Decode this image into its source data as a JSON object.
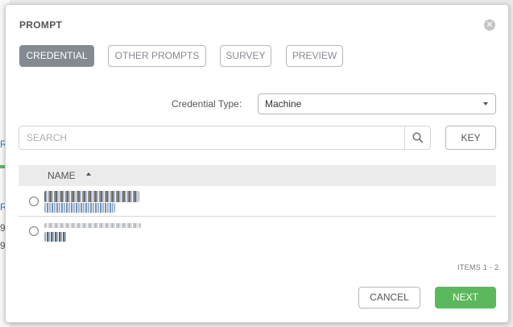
{
  "modal": {
    "title": "PROMPT",
    "close_icon": "close-icon"
  },
  "tabs": [
    {
      "label": "CREDENTIAL",
      "active": true
    },
    {
      "label": "OTHER PROMPTS",
      "active": false
    },
    {
      "label": "SURVEY",
      "active": false
    },
    {
      "label": "PREVIEW",
      "active": false
    }
  ],
  "credential_type": {
    "label": "Credential Type:",
    "selected": "Machine"
  },
  "search": {
    "placeholder": "SEARCH",
    "icon": "search-icon",
    "key_label": "KEY"
  },
  "table": {
    "column_name": "NAME",
    "sort": "ascending",
    "rows": [
      {
        "selected": false
      },
      {
        "selected": false
      }
    ]
  },
  "pagination": {
    "items_label": "ITEMS  1 - 2"
  },
  "footer": {
    "cancel_label": "CANCEL",
    "next_label": "NEXT"
  },
  "colors": {
    "accent_active_tab": "#848992",
    "primary_button": "#5cb85c"
  }
}
